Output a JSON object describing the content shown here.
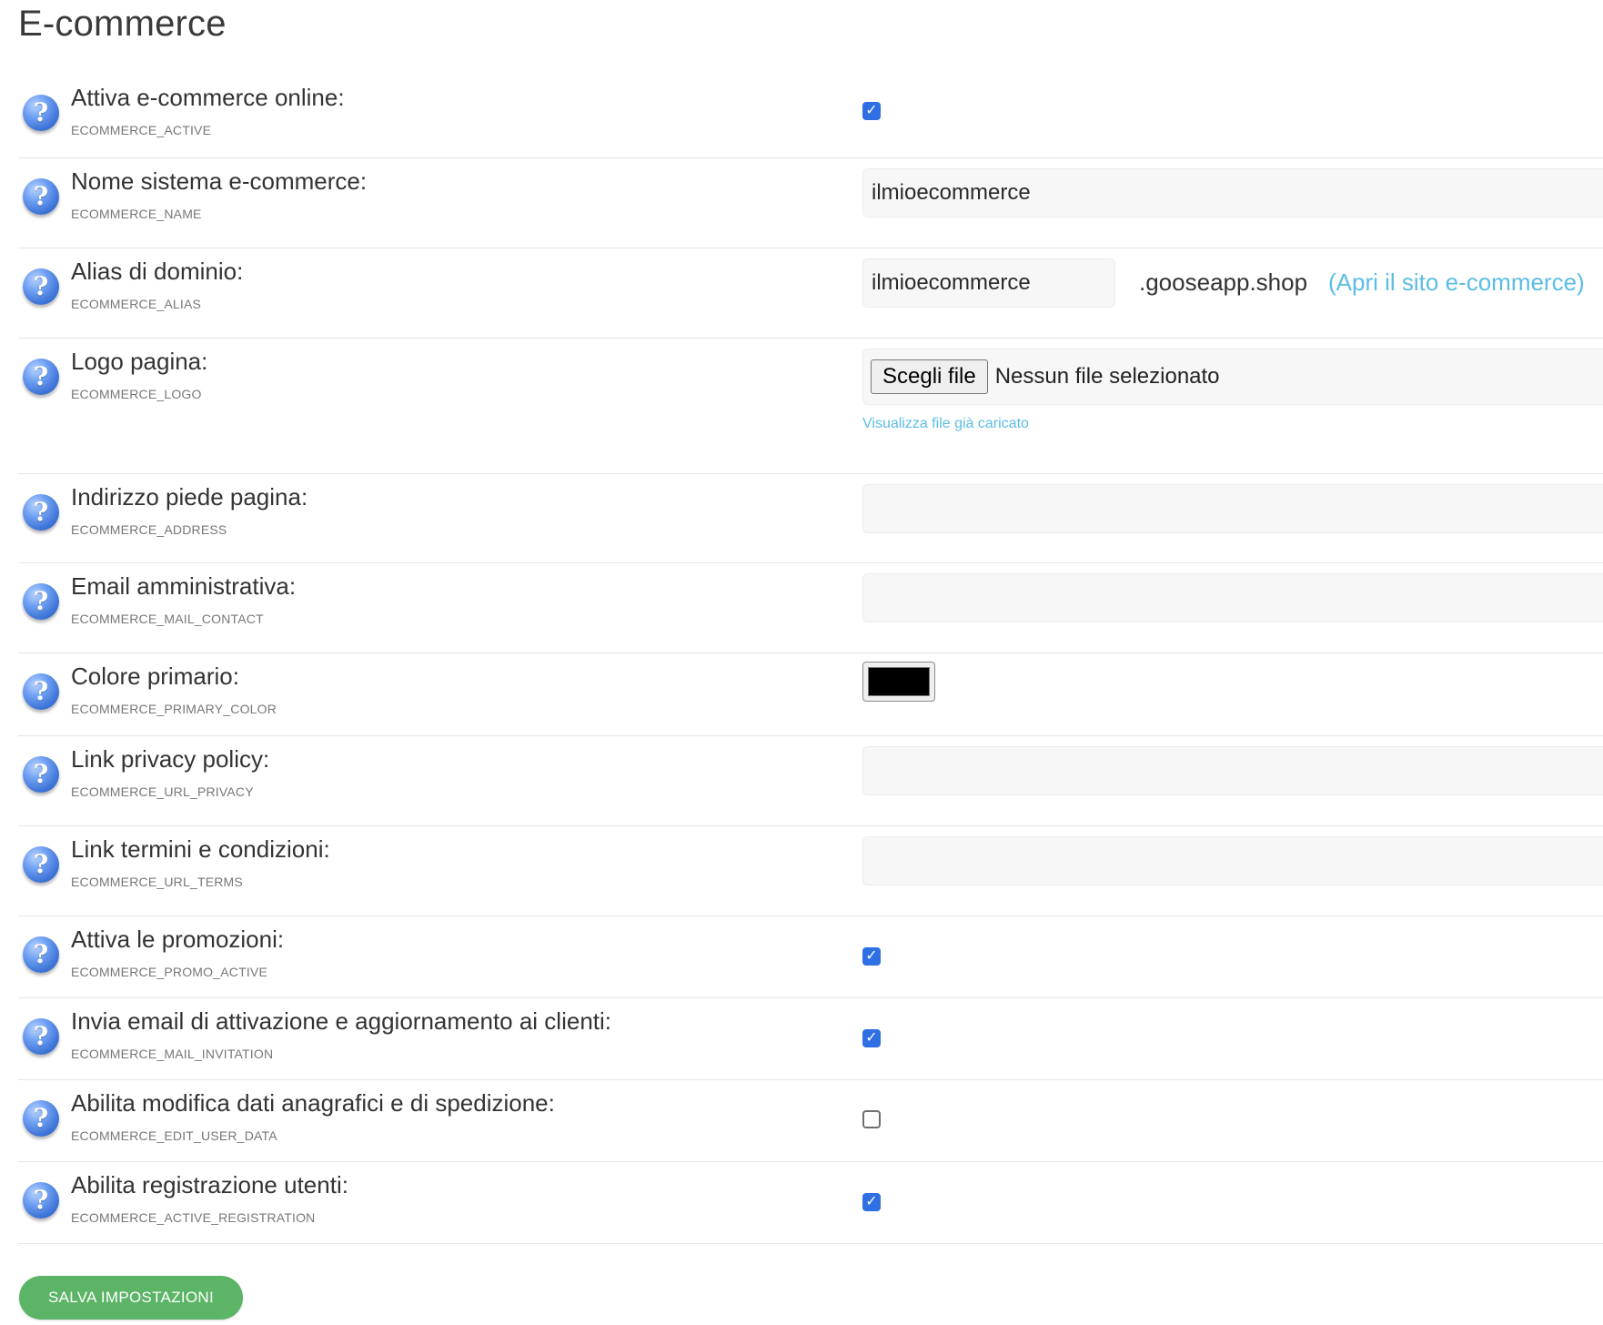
{
  "page": {
    "title": "E-commerce"
  },
  "settings": [
    {
      "label": "Attiva e-commerce online:",
      "key": "ECOMMERCE_ACTIVE",
      "type": "checkbox",
      "checked": true
    },
    {
      "label": "Nome sistema e-commerce:",
      "key": "ECOMMERCE_NAME",
      "type": "text",
      "value": "ilmioecommerce"
    },
    {
      "label": "Alias di dominio:",
      "key": "ECOMMERCE_ALIAS",
      "type": "alias",
      "value": "ilmioecommerce",
      "suffix": ".gooseapp.shop",
      "link": "(Apri il sito e-commerce)"
    },
    {
      "label": "Logo pagina:",
      "key": "ECOMMERCE_LOGO",
      "type": "file",
      "button_label": "Scegli file",
      "status": "Nessun file selezionato",
      "view_link": "Visualizza file già caricato"
    },
    {
      "label": "Indirizzo piede pagina:",
      "key": "ECOMMERCE_ADDRESS",
      "type": "text",
      "value": ""
    },
    {
      "label": "Email amministrativa:",
      "key": "ECOMMERCE_MAIL_CONTACT",
      "type": "text",
      "value": ""
    },
    {
      "label": "Colore primario:",
      "key": "ECOMMERCE_PRIMARY_COLOR",
      "type": "color",
      "value": "#000000"
    },
    {
      "label": "Link privacy policy:",
      "key": "ECOMMERCE_URL_PRIVACY",
      "type": "text",
      "value": ""
    },
    {
      "label": "Link termini e condizioni:",
      "key": "ECOMMERCE_URL_TERMS",
      "type": "text",
      "value": ""
    },
    {
      "label": "Attiva le promozioni:",
      "key": "ECOMMERCE_PROMO_ACTIVE",
      "type": "checkbox",
      "checked": true
    },
    {
      "label": "Invia email di attivazione e aggiornamento ai clienti:",
      "key": "ECOMMERCE_MAIL_INVITATION",
      "type": "checkbox",
      "checked": true
    },
    {
      "label": "Abilita modifica dati anagrafici e di spedizione:",
      "key": "ECOMMERCE_EDIT_USER_DATA",
      "type": "checkbox",
      "checked": false
    },
    {
      "label": "Abilita registrazione utenti:",
      "key": "ECOMMERCE_ACTIVE_REGISTRATION",
      "type": "checkbox",
      "checked": true
    }
  ],
  "help_icon_glyph": "?",
  "checkbox_glyph": "✓",
  "save_button": {
    "label": "SALVA IMPOSTAZIONI",
    "color": "#5cb466"
  },
  "colors": {
    "link": "#5bbde3",
    "checkbox_on": "#2f6fe4"
  }
}
